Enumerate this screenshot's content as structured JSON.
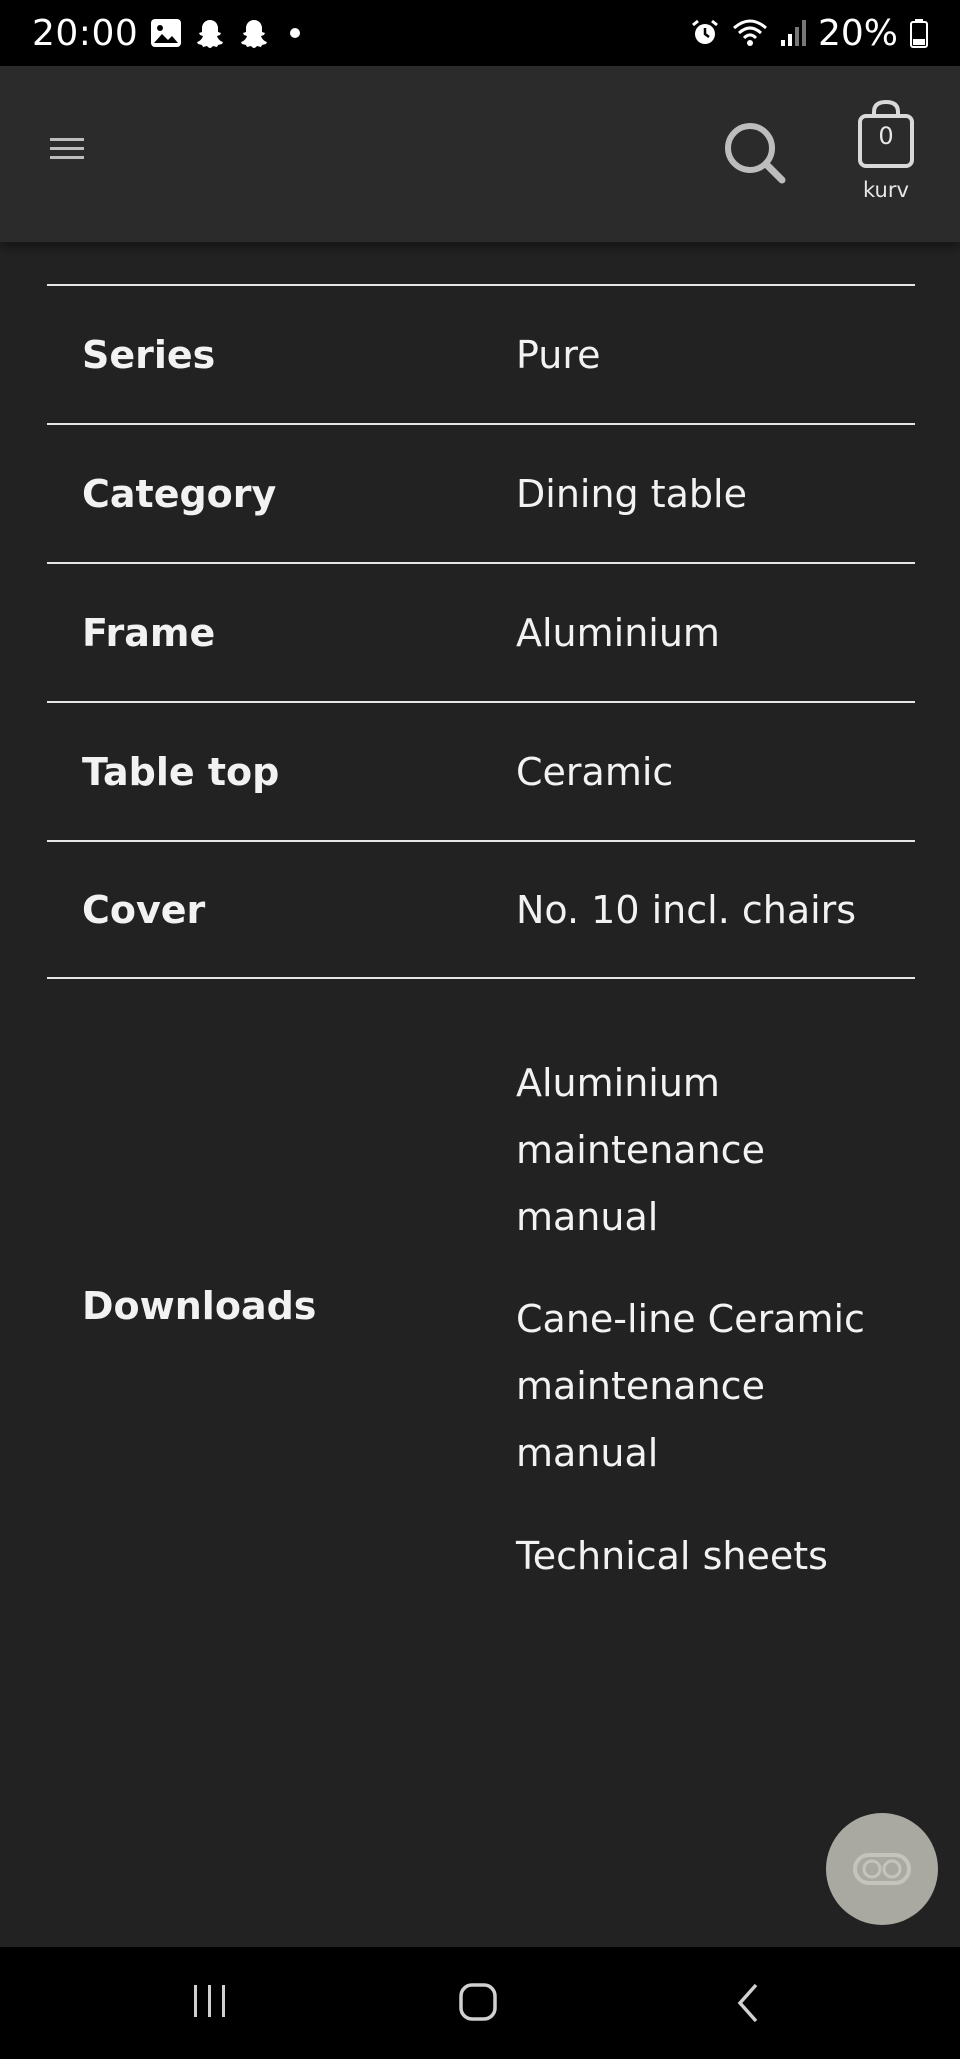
{
  "status_bar": {
    "time": "20:00",
    "battery": "20%",
    "icons": [
      "gallery-icon",
      "snapchat-icon",
      "snapchat-icon",
      "dot-icon",
      "alarm-icon",
      "wifi-icon",
      "signal-icon",
      "battery-icon"
    ]
  },
  "header": {
    "cart_count": "0",
    "cart_label": "kurv",
    "icons": [
      "menu-icon",
      "search-icon",
      "shopping-bag-icon"
    ]
  },
  "specs": {
    "rows": [
      {
        "label": "Series",
        "value": "Pure"
      },
      {
        "label": "Category",
        "value": "Dining table"
      },
      {
        "label": "Frame",
        "value": "Aluminium"
      },
      {
        "label": "Table top",
        "value": "Ceramic"
      },
      {
        "label": "Cover",
        "value": "No. 10 incl. chairs"
      }
    ]
  },
  "downloads": {
    "label": "Downloads",
    "links": [
      "Aluminium maintenance manual",
      "Cane-line Ceramic maintenance manual",
      "Technical sheets"
    ]
  },
  "colors": {
    "page_bg": "#222222",
    "header_bg": "#2b2b2b",
    "chat_button": "#a9a9a1",
    "text": "#f2f2f2"
  }
}
